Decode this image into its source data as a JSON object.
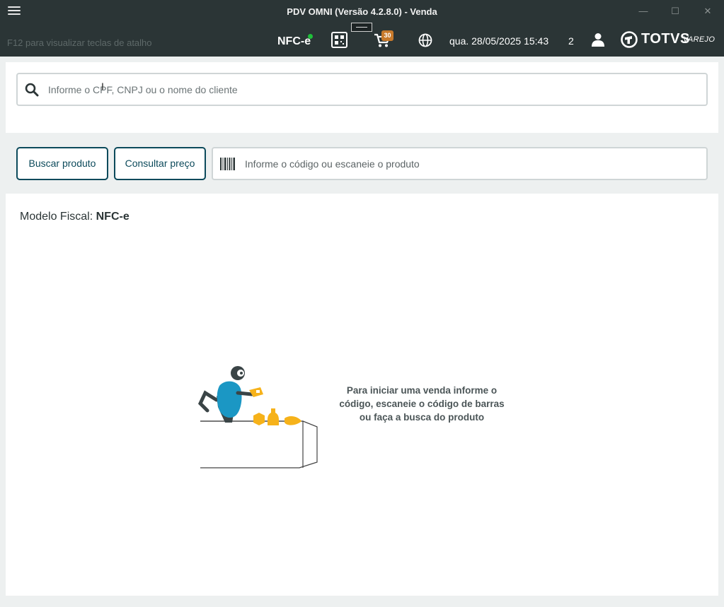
{
  "window": {
    "title": "PDV OMNI (Versão 4.2.8.0) - Venda",
    "minimize": "—",
    "maximize": "☐",
    "close": "✕"
  },
  "header": {
    "shortcut_hint": "F12 para visualizar teclas de atalho",
    "fiscal_model": "NFC-e",
    "fiscal_status_color": "#1fbf3a",
    "cart_badge": "30",
    "datetime": "qua. 28/05/2025 15:43",
    "terminal_count": "2",
    "brand": "TOTVS",
    "brand_sub": "VAREJO",
    "icons": [
      "menu-icon",
      "qr-code-icon",
      "cart-icon",
      "globe-icon",
      "user-icon",
      "totvs-logo-icon"
    ]
  },
  "client": {
    "placeholder": "Informe o CPF, CNPJ ou o nome do cliente",
    "value": ""
  },
  "product": {
    "buscar_label": "Buscar produto",
    "consultar_label": "Consultar preço",
    "barcode_placeholder": "Informe o código ou escaneie o produto",
    "barcode_value": ""
  },
  "main": {
    "fiscal_label": "Modelo Fiscal:",
    "fiscal_value": "NFC-e",
    "empty_message": "Para iniciar uma venda informe o código, escaneie o código de barras ou faça a busca do produto"
  },
  "colors": {
    "header_bg": "#2b3536",
    "accent": "#0c4a5b",
    "badge": "#c87a2c",
    "illustration_blue": "#1b97c4",
    "illustration_yellow": "#f6b21a"
  }
}
